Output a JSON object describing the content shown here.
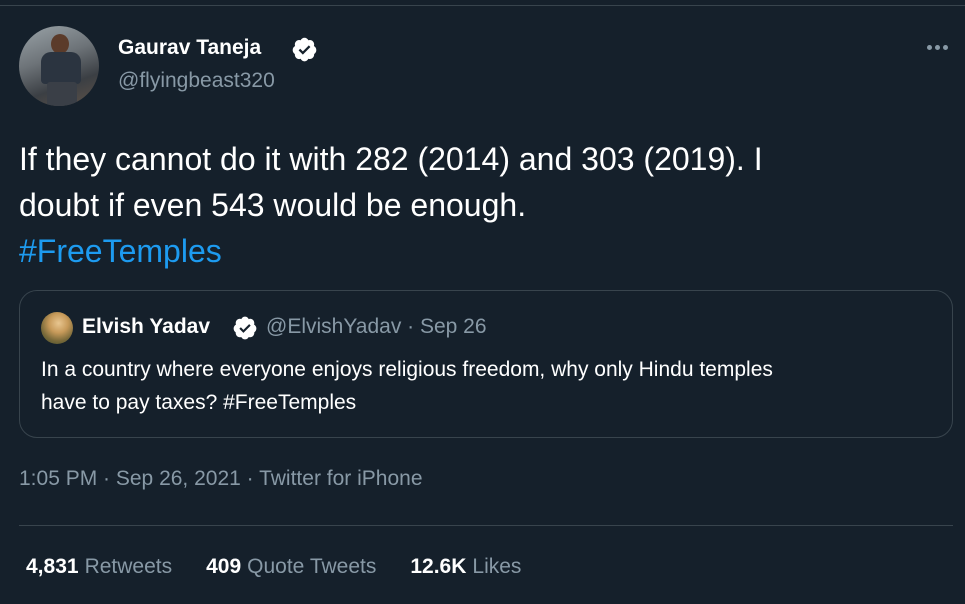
{
  "tweet": {
    "author": {
      "name": "Gaurav Taneja",
      "handle": "@flyingbeast320"
    },
    "text_line1": "If they cannot do it with 282 (2014) and 303 (2019). I",
    "text_line2": "doubt if even 543 would be enough.",
    "hashtag": "#FreeTemples",
    "quoted": {
      "name": "Elvish Yadav",
      "meta": "@ElvishYadav · Sep 26",
      "text_line1": "In a country where everyone enjoys religious freedom, why only Hindu temples",
      "text_line2": "have to pay taxes? #FreeTemples"
    },
    "timestamp": "1:05 PM · Sep 26, 2021 · Twitter for iPhone",
    "stats": {
      "retweets_count": "4,831",
      "retweets_label": "Retweets",
      "quotes_count": "409",
      "quotes_label": "Quote Tweets",
      "likes_count": "12.6K",
      "likes_label": "Likes"
    }
  },
  "colors": {
    "background": "#15202b",
    "accent": "#1d9bf0",
    "secondary_text": "#8899a6",
    "divider": "#38444d"
  }
}
